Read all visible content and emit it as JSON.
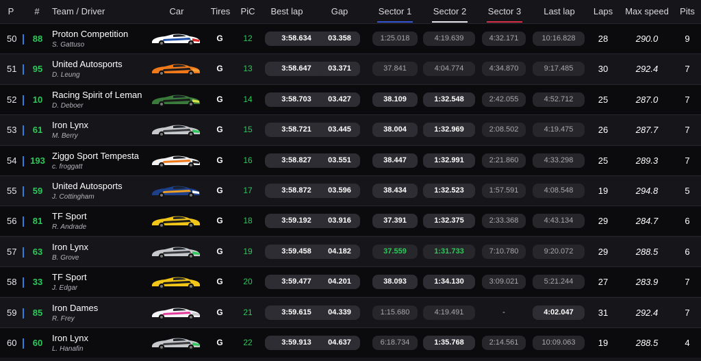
{
  "header": {
    "p": "P",
    "num": "#",
    "team_driver": "Team / Driver",
    "car": "Car",
    "tires": "Tires",
    "pic": "PiC",
    "best_lap": "Best lap",
    "gap": "Gap",
    "sector1": "Sector 1",
    "sector2": "Sector 2",
    "sector3": "Sector 3",
    "last_lap": "Last lap",
    "laps": "Laps",
    "max_speed": "Max speed",
    "pits": "Pits"
  },
  "colors": {
    "sector1": "#3a56d8",
    "sector2": "#e8e8ec",
    "sector3": "#d8324a",
    "class_bar": "#2f7fe0",
    "green": "#2ec95a"
  },
  "rows": [
    {
      "pos": "50",
      "num": "88",
      "team": "Proton Competition",
      "driver": "S. Gattuso",
      "tire": "G",
      "pic": "12",
      "best": "3:58.634",
      "gap": "03.358",
      "s1": "1:25.018",
      "s1s": "dim",
      "s2": "4:19.639",
      "s2s": "dim",
      "s3": "4:32.171",
      "s3s": "dim",
      "last": "10:16.828",
      "lasts": "dim",
      "laps": "28",
      "speed": "290.0",
      "pits": "9",
      "livery": [
        "#ffffff",
        "#1e4fa8",
        "#d92a2a"
      ]
    },
    {
      "pos": "51",
      "num": "95",
      "team": "United Autosports",
      "driver": "D. Leung",
      "tire": "G",
      "pic": "13",
      "best": "3:58.647",
      "gap": "03.371",
      "s1": "37.841",
      "s1s": "dim",
      "s2": "4:04.774",
      "s2s": "dim",
      "s3": "4:34.870",
      "s3s": "dim",
      "last": "9:17.485",
      "lasts": "dim",
      "laps": "30",
      "speed": "292.4",
      "pits": "7",
      "livery": [
        "#f07a1a",
        "#1b1b1f",
        "#f6a23a"
      ]
    },
    {
      "pos": "52",
      "num": "10",
      "team": "Racing Spirit of Leman",
      "driver": "D. Deboer",
      "tire": "G",
      "pic": "14",
      "best": "3:58.703",
      "gap": "03.427",
      "s1": "38.109",
      "s1s": "white",
      "s2": "1:32.548",
      "s2s": "white",
      "s3": "2:42.055",
      "s3s": "dim",
      "last": "4:52.712",
      "lasts": "dim",
      "laps": "25",
      "speed": "287.0",
      "pits": "7",
      "livery": [
        "#3a7a3a",
        "#1a1a1a",
        "#d6e24a"
      ]
    },
    {
      "pos": "53",
      "num": "61",
      "team": "Iron Lynx",
      "driver": "M. Berry",
      "tire": "G",
      "pic": "15",
      "best": "3:58.721",
      "gap": "03.445",
      "s1": "38.004",
      "s1s": "white",
      "s2": "1:32.969",
      "s2s": "white",
      "s3": "2:08.502",
      "s3s": "dim",
      "last": "4:19.475",
      "lasts": "dim",
      "laps": "26",
      "speed": "287.7",
      "pits": "7",
      "livery": [
        "#c6c8cc",
        "#3a3a3e",
        "#2ec95a"
      ]
    },
    {
      "pos": "54",
      "num": "193",
      "team": "Ziggo Sport Tempesta",
      "driver": "c. froggatt",
      "tire": "G",
      "pic": "16",
      "best": "3:58.827",
      "gap": "03.551",
      "s1": "38.447",
      "s1s": "white",
      "s2": "1:32.991",
      "s2s": "white",
      "s3": "2:21.860",
      "s3s": "dim",
      "last": "4:33.298",
      "lasts": "dim",
      "laps": "25",
      "speed": "289.3",
      "pits": "7",
      "livery": [
        "#f2f2f2",
        "#f07a1a",
        "#222226"
      ]
    },
    {
      "pos": "55",
      "num": "59",
      "team": "United Autosports",
      "driver": "J. Cottingham",
      "tire": "G",
      "pic": "17",
      "best": "3:58.872",
      "gap": "03.596",
      "s1": "38.434",
      "s1s": "white",
      "s2": "1:32.523",
      "s2s": "white",
      "s3": "1:57.591",
      "s3s": "dim",
      "last": "4:08.548",
      "lasts": "dim",
      "laps": "19",
      "speed": "294.8",
      "pits": "5",
      "livery": [
        "#1e3f8a",
        "#f0a020",
        "#ffffff"
      ]
    },
    {
      "pos": "56",
      "num": "81",
      "team": "TF Sport",
      "driver": "R. Andrade",
      "tire": "G",
      "pic": "18",
      "best": "3:59.192",
      "gap": "03.916",
      "s1": "37.391",
      "s1s": "white",
      "s2": "1:32.375",
      "s2s": "white",
      "s3": "2:33.368",
      "s3s": "dim",
      "last": "4:43.134",
      "lasts": "dim",
      "laps": "29",
      "speed": "284.7",
      "pits": "6",
      "livery": [
        "#f2c619",
        "#1a1a1a",
        "#f2c619"
      ]
    },
    {
      "pos": "57",
      "num": "63",
      "team": "Iron Lynx",
      "driver": "B. Grove",
      "tire": "G",
      "pic": "19",
      "best": "3:59.458",
      "gap": "04.182",
      "s1": "37.559",
      "s1s": "green",
      "s2": "1:31.733",
      "s2s": "green",
      "s3": "7:10.780",
      "s3s": "dim",
      "last": "9:20.072",
      "lasts": "dim",
      "laps": "29",
      "speed": "288.5",
      "pits": "6",
      "livery": [
        "#c6c8cc",
        "#3a3a3e",
        "#2ec95a"
      ]
    },
    {
      "pos": "58",
      "num": "33",
      "team": "TF Sport",
      "driver": "J. Edgar",
      "tire": "G",
      "pic": "20",
      "best": "3:59.477",
      "gap": "04.201",
      "s1": "38.093",
      "s1s": "white",
      "s2": "1:34.130",
      "s2s": "white",
      "s3": "3:09.021",
      "s3s": "dim",
      "last": "5:21.244",
      "lasts": "dim",
      "laps": "27",
      "speed": "283.9",
      "pits": "7",
      "livery": [
        "#f2c619",
        "#1a1a1a",
        "#f2c619"
      ]
    },
    {
      "pos": "59",
      "num": "85",
      "team": "Iron Dames",
      "driver": "R. Frey",
      "tire": "G",
      "pic": "21",
      "best": "3:59.615",
      "gap": "04.339",
      "s1": "1:15.680",
      "s1s": "dim",
      "s2": "4:19.491",
      "s2s": "dim",
      "s3": "-",
      "s3s": "plain",
      "last": "4:02.047",
      "lasts": "white",
      "laps": "31",
      "speed": "292.4",
      "pits": "7",
      "livery": [
        "#f4f4f6",
        "#e23a9a",
        "#c6c8cc"
      ]
    },
    {
      "pos": "60",
      "num": "60",
      "team": "Iron Lynx",
      "driver": "L. Hanafin",
      "tire": "G",
      "pic": "22",
      "best": "3:59.913",
      "gap": "04.637",
      "s1": "6:18.734",
      "s1s": "dim",
      "s2": "1:35.768",
      "s2s": "white",
      "s3": "2:14.561",
      "s3s": "dim",
      "last": "10:09.063",
      "lasts": "dim",
      "laps": "19",
      "speed": "288.5",
      "pits": "4",
      "livery": [
        "#c6c8cc",
        "#3a3a3e",
        "#2ec95a"
      ]
    }
  ]
}
